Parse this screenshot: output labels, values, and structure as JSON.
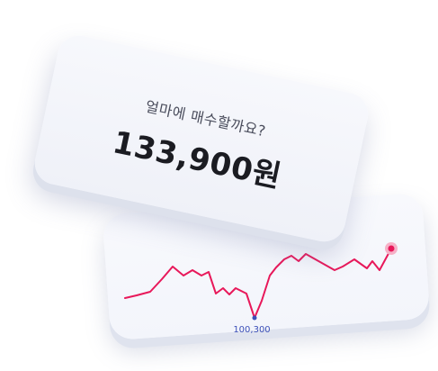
{
  "order_card": {
    "question": "얼마에 매수할까요?",
    "price": "133,900원"
  },
  "chart_data": {
    "type": "line",
    "min_label": "100,300",
    "colors": {
      "line": "#e8185a",
      "min_dot": "#3b4fb8"
    }
  }
}
